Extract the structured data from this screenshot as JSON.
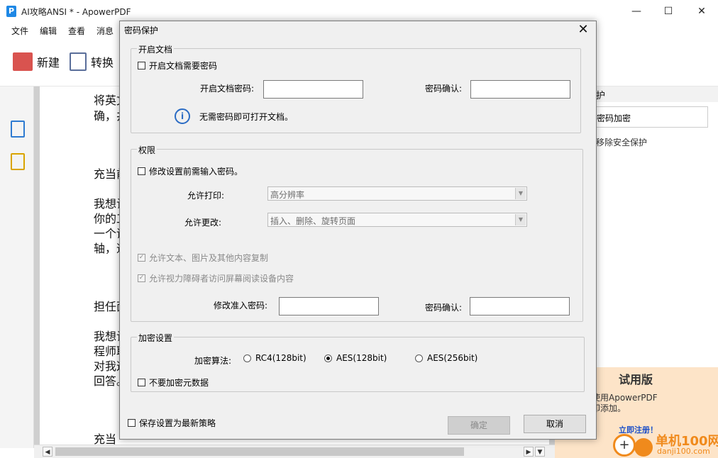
{
  "window": {
    "title": "AI攻略ANSI * - ApowerPDF",
    "logo_letter": "P",
    "minimize": "—",
    "maximize": "☐",
    "close": "✕"
  },
  "menu": [
    "文件",
    "编辑",
    "查看",
    "消息"
  ],
  "toolbar": {
    "new_label": "新建",
    "convert_label": "转换"
  },
  "document": {
    "lines": [
      "将英文",
      "确，井",
      "充当前",
      "我想让",
      "你的工",
      "一个话",
      "轴，道",
      "担任面",
      "我想让",
      "程师耶",
      "对我这",
      "回答。",
      "充当"
    ]
  },
  "right_panel": {
    "header": "护",
    "password_encrypt": "密码加密",
    "remove_security": "移除安全保护",
    "trial_title": "试用版",
    "trial_text_1": "使用ApowerPDF",
    "trial_text_2": "印添加。",
    "trial_link": "立即注册！"
  },
  "watermark": {
    "text": "单机100网",
    "url": "danji100.com",
    "symbol": "+"
  },
  "dialog": {
    "title": "密码保护",
    "close": "✕",
    "open_doc": {
      "group_label": "开启文档",
      "require_label": "开启文档需要密码",
      "password_label": "开启文档密码:",
      "confirm_label": "密码确认:",
      "info_icon": "i",
      "info_text": "无需密码即可打开文档。"
    },
    "permissions": {
      "group_label": "权限",
      "require_label": "修改设置前需输入密码。",
      "print_label": "允许打印:",
      "print_value": "高分辨率",
      "change_label": "允许更改:",
      "change_value": "插入、删除、旋转页面",
      "copy_label": "允许文本、图片及其他内容复制",
      "access_label": "允许视力障碍者访问屏幕阅读设备内容",
      "check_mark": "✓",
      "password_label": "修改准入密码:",
      "confirm_label": "密码确认:"
    },
    "encryption": {
      "group_label": "加密设置",
      "algorithm_label": "加密算法:",
      "options": [
        "RC4(128bit)",
        "AES(128bit)",
        "AES(256bit)"
      ],
      "selected": "AES(128bit)",
      "no_metadata_label": "不要加密元数据"
    },
    "save_policy_label": "保存设置为最新策略",
    "ok_label": "确定",
    "cancel_label": "取消"
  }
}
